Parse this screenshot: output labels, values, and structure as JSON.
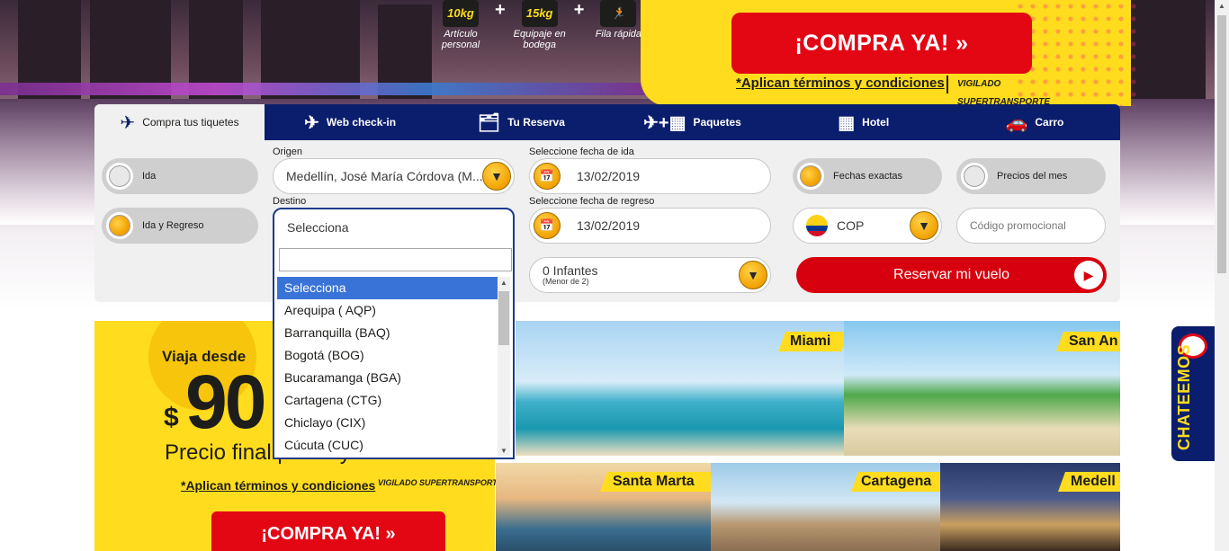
{
  "hero": {
    "perks": [
      {
        "box": "10kg",
        "label": "Artículo personal"
      },
      {
        "box": "15kg",
        "label": "Equipaje en bodega"
      },
      {
        "box": "",
        "label": "Fila rápida"
      }
    ],
    "cta": "¡COMPRA YA!  »",
    "terms": "*Aplican términos y condiciones",
    "vigilado": "VIGILADO SUPERTRANSPORTE"
  },
  "tabs": [
    {
      "label": "Compra tus tiquetes",
      "icon": "plane-ticket-icon"
    },
    {
      "label": "Web check-in",
      "icon": "plane-checkin-icon"
    },
    {
      "label": "Tu Reserva",
      "icon": "reservation-icon"
    },
    {
      "label": "Paquetes",
      "icon": "plane-hotel-icon"
    },
    {
      "label": "Hotel",
      "icon": "hotel-icon"
    },
    {
      "label": "Carro",
      "icon": "car-icon"
    }
  ],
  "form": {
    "trip_types": [
      {
        "label": "Ida",
        "selected": false
      },
      {
        "label": "Ida y Regreso",
        "selected": true
      }
    ],
    "origin_label": "Origen",
    "origin_value": "Medellín, José María Córdova (M...",
    "dest_label": "Destino",
    "dest_value": "Selecciona",
    "date_out_label": "Seleccione fecha de ida",
    "date_out_value": "13/02/2019",
    "date_back_label": "Seleccione fecha de regreso",
    "date_back_value": "13/02/2019",
    "infants_value": "0 Infantes",
    "infants_note": "(Menor de 2)",
    "fechas_exactas": "Fechas exactas",
    "precios_mes": "Precios del mes",
    "currency": "COP",
    "promo_placeholder": "Código promocional",
    "reserve_label": "Reservar mi vuelo"
  },
  "dropdown": {
    "search_value": "",
    "options": [
      "Selecciona",
      "Arequipa ( AQP)",
      "Barranquilla (BAQ)",
      "Bogotá (BOG)",
      "Bucaramanga (BGA)",
      "Cartagena (CTG)",
      "Chiclayo (CIX)",
      "Cúcuta (CUC)"
    ],
    "highlighted": "Selecciona"
  },
  "banner": {
    "viaja": "Viaja desde",
    "currency_symbol": "$",
    "price": "90",
    "precio": "Precio final  por trayecto",
    "terms": "*Aplican términos y condiciones",
    "vigilado": "VIGILADO SUPERTRANSPORTE",
    "cta": "¡COMPRA YA!  »"
  },
  "destinations": [
    "Miami",
    "San An",
    "Santa Marta",
    "Cartagena",
    "Medell"
  ],
  "chat": {
    "label": "CHATEEMOS"
  },
  "colors": {
    "navy": "#0b1e6d",
    "yellow": "#ffdc1e",
    "red": "#e30613",
    "orange": "#f2a100"
  }
}
